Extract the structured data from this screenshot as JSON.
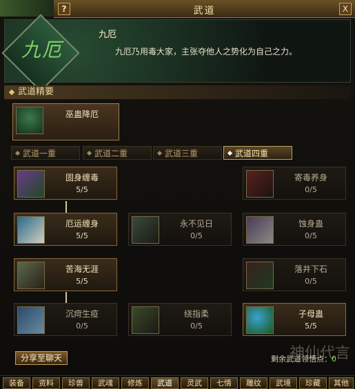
{
  "window": {
    "title": "武道",
    "help": "?",
    "close": "X"
  },
  "header": {
    "portrait_text": "九厄",
    "name": "九厄",
    "description": "九厄乃用毒大家，主张夺他人之势化为自己之力。"
  },
  "section_title": "武道精要",
  "top_skill": {
    "name": "巫蛊降厄"
  },
  "tabs": [
    {
      "label": "武道一重"
    },
    {
      "label": "武道二重"
    },
    {
      "label": "武道三重"
    },
    {
      "label": "武道四重",
      "active": true
    }
  ],
  "skills": [
    {
      "name": "固身缠毒",
      "level": "5/5",
      "icon_name": "poison-snake-icon",
      "color": "#6a3a8a"
    },
    {
      "name": "寄毒养身",
      "level": "0/5",
      "icon_name": "leech-icon",
      "color": "#5a2020"
    },
    {
      "name": "厄运缠身",
      "level": "5/5",
      "icon_name": "curse-arm-icon",
      "color": "#2a6a8a"
    },
    {
      "name": "永不见日",
      "level": "0/5",
      "icon_name": "shadow-beast-icon",
      "color": "#3a4a3a"
    },
    {
      "name": "蚀身蛊",
      "level": "0/5",
      "icon_name": "corrode-arm-icon",
      "color": "#4a3a5a"
    },
    {
      "name": "苦海无涯",
      "level": "5/5",
      "icon_name": "sea-beast-icon",
      "color": "#5a6a4a"
    },
    {
      "name": "落井下石",
      "level": "0/5",
      "icon_name": "stone-fall-icon",
      "color": "#3a2020"
    },
    {
      "name": "沉疴生疫",
      "level": "0/5",
      "icon_name": "plague-blade-icon",
      "color": "#2a4a6a"
    },
    {
      "name": "绕指柔",
      "level": "0/5",
      "icon_name": "finger-icon",
      "color": "#3a4a2a"
    },
    {
      "name": "子母蛊",
      "level": "5/5",
      "icon_name": "mother-gu-icon",
      "color": "#2a7a2a"
    }
  ],
  "share_button": "分享至聊天",
  "points": {
    "label": "剩余武道领悟点：",
    "value": "0"
  },
  "watermark": "神仙代言",
  "bottom_tabs": [
    "装备",
    "资料",
    "珍兽",
    "武魂",
    "修炼",
    "武道",
    "灵武",
    "七情",
    "雕纹",
    "武境",
    "珍藏",
    "其他"
  ]
}
